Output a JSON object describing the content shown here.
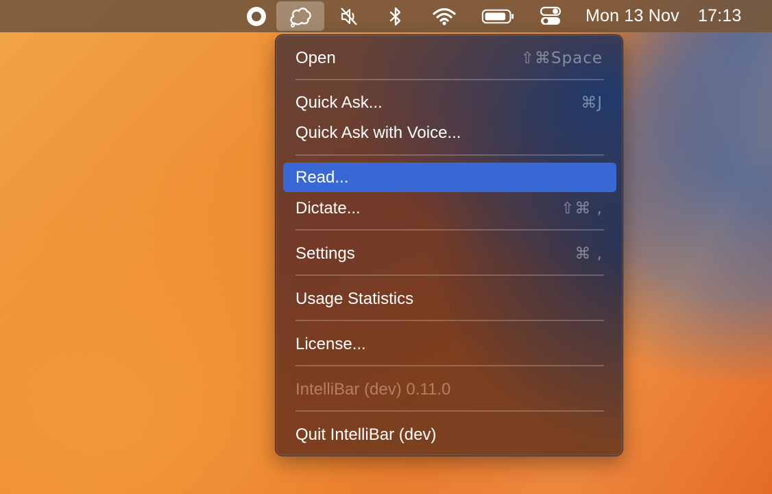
{
  "menubar": {
    "icons": [
      {
        "name": "record-icon",
        "symbol": "circle"
      },
      {
        "name": "intellibar-icon",
        "symbol": "cloud-outline",
        "active": true
      },
      {
        "name": "muted-speaker-icon",
        "symbol": "speaker-slash"
      },
      {
        "name": "bluetooth-icon",
        "symbol": "bluetooth"
      },
      {
        "name": "wifi-icon",
        "symbol": "wifi"
      },
      {
        "name": "battery-icon",
        "symbol": "battery"
      },
      {
        "name": "control-center-icon",
        "symbol": "toggles"
      }
    ],
    "date": "Mon 13 Nov",
    "time": "17:13"
  },
  "menu": {
    "items": [
      {
        "label": "Open",
        "shortcut": "⇧⌘Space"
      },
      {
        "label": "Quick Ask...",
        "shortcut": "⌘J"
      },
      {
        "label": "Quick Ask with Voice...",
        "shortcut": ""
      },
      {
        "label": "Read...",
        "shortcut": "",
        "highlighted": true
      },
      {
        "label": "Dictate...",
        "shortcut": "⇧⌘ ,"
      },
      {
        "label": "Settings",
        "shortcut": "⌘ ,"
      },
      {
        "label": "Usage Statistics",
        "shortcut": ""
      },
      {
        "label": "License...",
        "shortcut": ""
      },
      {
        "label": "IntelliBar (dev) 0.11.0",
        "shortcut": "",
        "disabled": true
      },
      {
        "label": "Quit IntelliBar (dev)",
        "shortcut": ""
      }
    ]
  },
  "colors": {
    "highlight": "#3868d4",
    "menubar": "#78583c",
    "text": "#ffffff"
  }
}
